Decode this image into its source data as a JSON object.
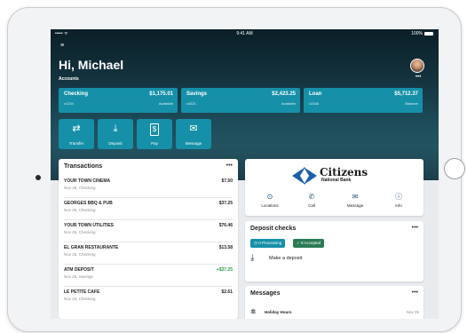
{
  "status_bar": {
    "signal": "••••• ᯤ",
    "time": "9:41 AM",
    "battery": "100%"
  },
  "greeting": "Hi, Michael",
  "accounts_label": "Accounts",
  "accounts": [
    {
      "name": "Checking",
      "sub": "x1234",
      "value": "$1,175.01",
      "note": "Available"
    },
    {
      "name": "Savings",
      "sub": "x4321",
      "value": "$2,423.25",
      "note": "Available"
    },
    {
      "name": "Loan",
      "sub": "x2345",
      "value": "$5,712.37",
      "note": "Balance"
    }
  ],
  "quick_actions": [
    {
      "label": "Transfer",
      "icon": "transfer-icon",
      "glyph": "⇄"
    },
    {
      "label": "Deposit",
      "icon": "deposit-icon",
      "glyph": "⤓"
    },
    {
      "label": "Pay",
      "icon": "pay-icon",
      "glyph": "$"
    },
    {
      "label": "Message",
      "icon": "message-icon",
      "glyph": "✉"
    }
  ],
  "transactions": {
    "title": "Transactions",
    "more": "•••",
    "items": [
      {
        "merchant": "YOUR TOWN CINEMA",
        "date": "Nov 25, Checking",
        "amount": "$7.50"
      },
      {
        "merchant": "GEORGES BBQ & PUB",
        "date": "Nov 25, Checking",
        "amount": "$37.25"
      },
      {
        "merchant": "YOUR TOWN UTILITIES",
        "date": "Nov 25, Checking",
        "amount": "$76.46"
      },
      {
        "merchant": "EL GRAN RESTAURANTE",
        "date": "Nov 25, Checking",
        "amount": "$13.58"
      },
      {
        "merchant": "ATM DEPOSIT",
        "date": "Nov 25, Savings",
        "amount": "+$37.25"
      },
      {
        "merchant": "LE PETITE CAFE",
        "date": "Nov 24, Checking",
        "amount": "$2.61"
      }
    ]
  },
  "bank": {
    "name": "Citizens",
    "sub": "National Bank",
    "actions": [
      {
        "label": "Locations",
        "icon": "location-pin-icon",
        "glyph": "⊙"
      },
      {
        "label": "Call",
        "icon": "phone-icon",
        "glyph": "✆"
      },
      {
        "label": "Message",
        "icon": "message-icon",
        "glyph": "✉"
      },
      {
        "label": "Info",
        "icon": "info-icon",
        "glyph": "ⓘ"
      }
    ]
  },
  "deposit": {
    "title": "Deposit checks",
    "more": "•••",
    "processing": "0 Processing",
    "accepted": "✓ 9 Accepted",
    "make_deposit": "Make a deposit"
  },
  "messages": {
    "title": "Messages",
    "more": "•••",
    "first": {
      "title": "Holiday Hours",
      "date": "Nov 25"
    }
  },
  "colors": {
    "accent": "#1690a8",
    "accepted": "#2b7a55",
    "positive": "#2f9a4a"
  }
}
